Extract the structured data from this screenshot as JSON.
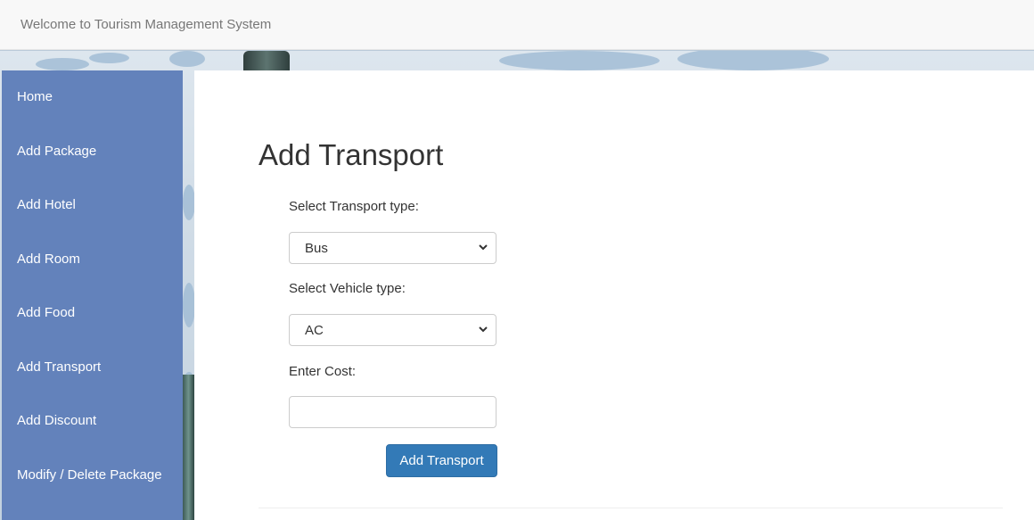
{
  "navbar": {
    "brand": "Welcome to Tourism Management System"
  },
  "sidebar": {
    "items": [
      {
        "label": "Home"
      },
      {
        "label": "Add Package"
      },
      {
        "label": "Add Hotel"
      },
      {
        "label": "Add Room"
      },
      {
        "label": "Add Food"
      },
      {
        "label": "Add Transport"
      },
      {
        "label": "Add Discount"
      },
      {
        "label": "Modify / Delete Package"
      }
    ]
  },
  "form": {
    "title": "Add Transport",
    "transport_type_label": "Select Transport type:",
    "transport_type_value": "Bus",
    "vehicle_type_label": "Select Vehicle type:",
    "vehicle_type_value": "AC",
    "cost_label": "Enter Cost:",
    "cost_value": "",
    "submit_label": "Add Transport"
  },
  "colors": {
    "sidebar": "#6382bb",
    "primary_button": "#337ab7",
    "navbar": "#f8f8f8"
  }
}
